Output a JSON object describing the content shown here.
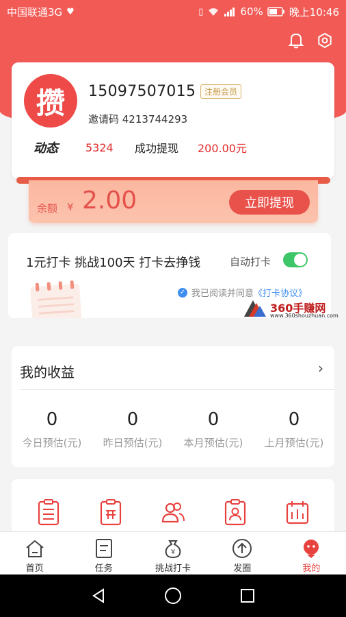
{
  "status_bar": {
    "carrier": "中国联通3G",
    "battery": "60%",
    "time": "晚上10:46"
  },
  "header": {
    "icons": [
      "bell-icon",
      "settings-icon"
    ]
  },
  "profile": {
    "avatar_char": "攒",
    "phone": "15097507015",
    "member_badge": "注册会员",
    "invite_code": "邀请码 4213744293",
    "dynamic_label": "动态",
    "dynamic_value": "5324",
    "withdraw_label": "成功提现",
    "withdraw_value": "200.00元"
  },
  "balance": {
    "label": "余额",
    "currency": "¥",
    "amount": "2.00",
    "button": "立即提现"
  },
  "checkin": {
    "title": "1元打卡 挑战100天 打卡去挣钱",
    "auto_label": "自动打卡",
    "auto_on": true,
    "agree_prefix": "我已阅读并同意",
    "agree_link": "《打卡协议》"
  },
  "watermark": {
    "main": "360手赚网",
    "sub": "www.360shouzhuan.com"
  },
  "income": {
    "title": "我的收益",
    "stats": [
      {
        "value": "0",
        "label": "今日预估(元)"
      },
      {
        "value": "0",
        "label": "昨日预估(元)"
      },
      {
        "value": "0",
        "label": "本月预估(元)"
      },
      {
        "value": "0",
        "label": "上月预估(元)"
      }
    ]
  },
  "tabbar": {
    "tabs": [
      {
        "label": "首页",
        "icon": "home-icon"
      },
      {
        "label": "任务",
        "icon": "task-icon"
      },
      {
        "label": "挑战打卡",
        "icon": "money-bag-icon"
      },
      {
        "label": "发圈",
        "icon": "upload-icon"
      },
      {
        "label": "我的",
        "icon": "profile-icon",
        "active": true
      }
    ]
  },
  "colors": {
    "brand": "#f25a56",
    "accent_red": "#e42a2a",
    "toggle_on": "#3ec66a",
    "link_blue": "#3e8df0"
  }
}
